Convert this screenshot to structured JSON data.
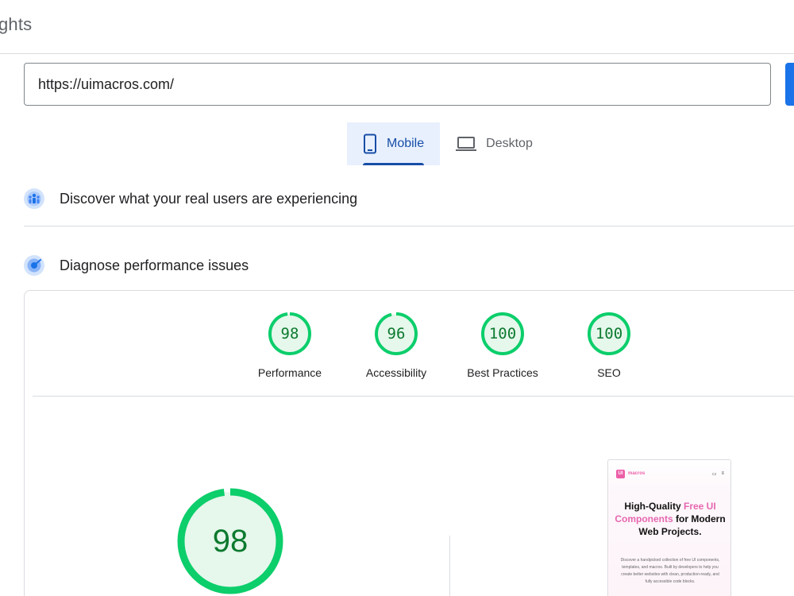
{
  "header": {
    "brand_fragment": "ghts"
  },
  "url_input": {
    "value": "https://uimacros.com/"
  },
  "tabs": [
    {
      "label": "Mobile",
      "icon": "smartphone-icon",
      "active": true
    },
    {
      "label": "Desktop",
      "icon": "laptop-icon",
      "active": false
    }
  ],
  "sections": {
    "real_users": {
      "label": "Discover what your real users are experiencing",
      "icon": "users-icon"
    },
    "diagnose": {
      "label": "Diagnose performance issues",
      "icon": "lighthouse-icon"
    }
  },
  "scores": [
    {
      "label": "Performance",
      "value": "98",
      "fraction": 0.98
    },
    {
      "label": "Accessibility",
      "value": "96",
      "fraction": 0.96
    },
    {
      "label": "Best Practices",
      "value": "100",
      "fraction": 1.0
    },
    {
      "label": "SEO",
      "value": "100",
      "fraction": 1.0
    }
  ],
  "main_score": {
    "value": "98",
    "fraction": 0.98
  },
  "colors": {
    "pass_green": "#0cce6b",
    "pass_fill": "#e6f7ec",
    "accent_blue": "#1a73e8",
    "active_tab": "#174ea6",
    "brand_pink": "#ec5fa8"
  },
  "preview": {
    "logo_badge": "UI",
    "logo_text": "macros",
    "title_parts": [
      "High-Quality ",
      "Free UI Components",
      " for Modern Web Projects."
    ],
    "description": "Discover a handpicked collection of free UI components, templates, and macros. Built by developers to help you create better websites with clean, production-ready, and fully accessible code blocks."
  }
}
